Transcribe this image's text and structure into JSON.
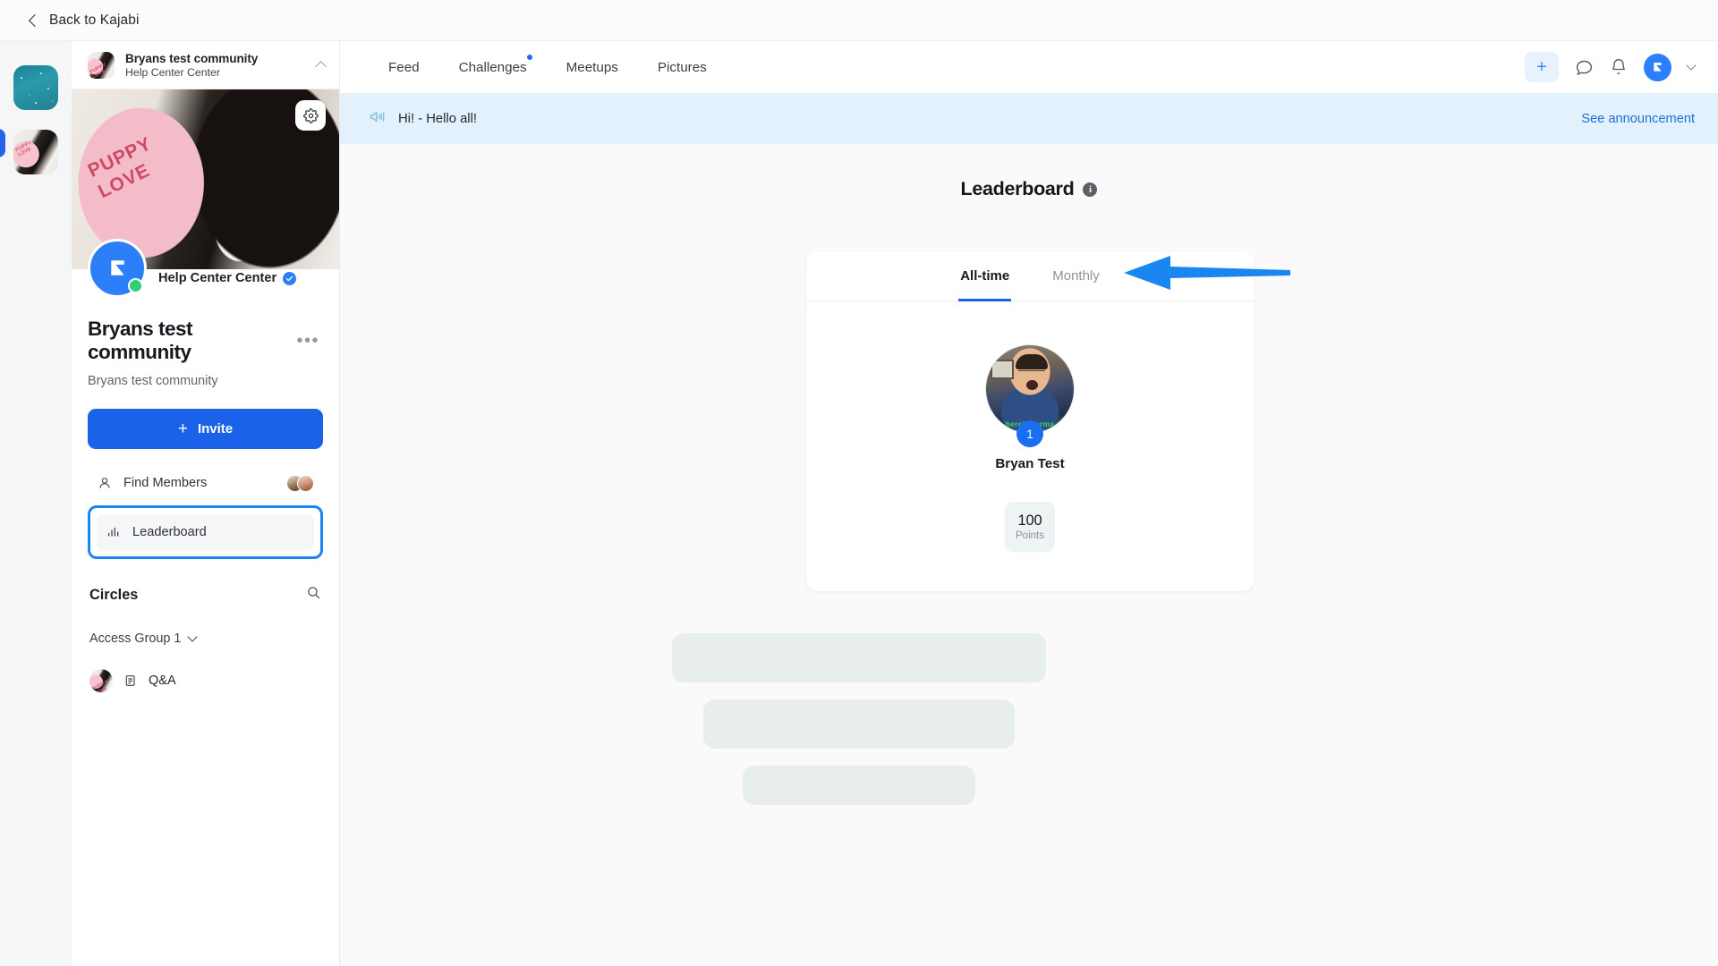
{
  "topbar": {
    "back_label": "Back to Kajabi",
    "back_icon": "chevron-left-icon"
  },
  "rail": {
    "items": [
      {
        "name": "space-community-thumb",
        "selected": false
      },
      {
        "name": "puppy-community-thumb",
        "selected": true
      }
    ]
  },
  "sidebar": {
    "header": {
      "title": "Bryans test community",
      "subtitle": "Help Center Center",
      "caret_icon": "chevron-up-icon",
      "avatar": "community-avatar"
    },
    "cover": {
      "image_alt": "PUPPY LOVE",
      "settings_icon": "gear-icon"
    },
    "brand": {
      "name": "Help Center Center",
      "verified_icon": "verified-badge-icon",
      "logo_icon": "kajabi-logo-icon",
      "status": "online"
    },
    "community": {
      "title": "Bryans test community",
      "subtitle": "Bryans test community",
      "more_icon": "ellipsis-icon"
    },
    "invite": {
      "label": "Invite",
      "icon": "plus-icon"
    },
    "nav": [
      {
        "label": "Find Members",
        "icon": "person-icon",
        "name": "sidebar-item-find-members",
        "active": false
      },
      {
        "label": "Leaderboard",
        "icon": "bar-chart-icon",
        "name": "sidebar-item-leaderboard",
        "active": true
      }
    ],
    "circles": {
      "title": "Circles",
      "search_icon": "search-icon",
      "group": {
        "label": "Access Group 1",
        "caret_icon": "chevron-down-icon"
      },
      "channels": [
        {
          "label": "Q&A",
          "icon": "document-icon",
          "avatar": "circle-avatar"
        }
      ]
    }
  },
  "main": {
    "tabs": [
      {
        "label": "Feed",
        "badge": false
      },
      {
        "label": "Challenges",
        "badge": true
      },
      {
        "label": "Meetups",
        "badge": false
      },
      {
        "label": "Pictures",
        "badge": false
      }
    ],
    "actions": {
      "create_label": "+",
      "create_icon": "plus-icon",
      "chat_icon": "chat-bubble-icon",
      "bell_icon": "bell-icon",
      "avatar_icon": "kajabi-logo-icon",
      "caret_icon": "chevron-down-icon"
    },
    "announcement": {
      "icon": "megaphone-icon",
      "text": "Hi! - Hello all!",
      "link": "See announcement"
    },
    "leaderboard": {
      "title": "Leaderboard",
      "info_icon": "info-icon",
      "info_glyph": "i",
      "tabs": [
        {
          "label": "All-time",
          "active": true
        },
        {
          "label": "Monthly",
          "active": false
        }
      ],
      "winner": {
        "rank": "1",
        "name": "Bryan Test",
        "avatar_caption": "here's karma",
        "points_value": "100",
        "points_label": "Points"
      }
    }
  },
  "annotation": {
    "arrow_icon": "left-arrow-annotation",
    "color": "#1a86f0"
  },
  "colors": {
    "accent_blue": "#1a63e8",
    "highlight_blue": "#1a86f0",
    "announcement_bg": "#e2f1fb",
    "main_bg": "#fafafa",
    "rail_bg": "#f4f6f8"
  }
}
